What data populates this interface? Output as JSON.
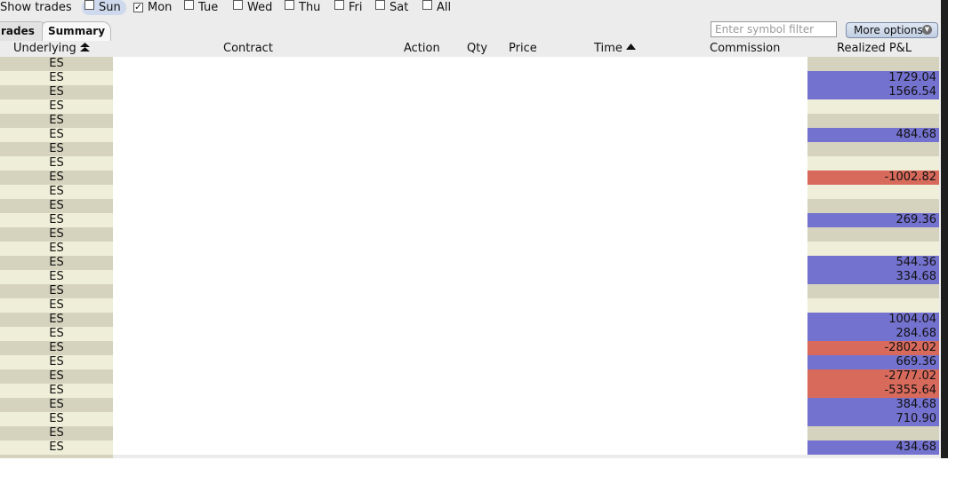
{
  "show_trades": {
    "label": "Show trades",
    "days": [
      {
        "label": "Sun",
        "checked": false,
        "highlighted": true
      },
      {
        "label": "Mon",
        "checked": true,
        "highlighted": false
      },
      {
        "label": "Tue",
        "checked": false,
        "highlighted": false
      },
      {
        "label": "Wed",
        "checked": false,
        "highlighted": false
      },
      {
        "label": "Thu",
        "checked": false,
        "highlighted": false
      },
      {
        "label": "Fri",
        "checked": false,
        "highlighted": false
      },
      {
        "label": "Sat",
        "checked": false,
        "highlighted": false
      },
      {
        "label": "All",
        "checked": false,
        "highlighted": false
      }
    ]
  },
  "tabs": [
    {
      "label": "rades",
      "active": false
    },
    {
      "label": "Summary",
      "active": true
    }
  ],
  "symbol_filter": {
    "placeholder": "Enter symbol filter",
    "value": ""
  },
  "more_options": {
    "label": "More options"
  },
  "columns": {
    "underlying": "Underlying",
    "contract": "Contract",
    "action": "Action",
    "qty": "Qty",
    "price": "Price",
    "time": "Time",
    "commission": "Commission",
    "realized_pnl": "Realized P&L"
  },
  "sort_icons": {
    "underlying": "double-up-arrow-icon",
    "time": "up-triangle-icon"
  },
  "colors": {
    "positive_pnl": "#7472cf",
    "negative_pnl": "#d86a5c",
    "stripe_odd": "#d5d3be",
    "stripe_even": "#efeed8"
  },
  "rows": [
    {
      "underlying": "ES",
      "pnl": ""
    },
    {
      "underlying": "ES",
      "pnl": "1729.04"
    },
    {
      "underlying": "ES",
      "pnl": "1566.54"
    },
    {
      "underlying": "ES",
      "pnl": ""
    },
    {
      "underlying": "ES",
      "pnl": ""
    },
    {
      "underlying": "ES",
      "pnl": "484.68"
    },
    {
      "underlying": "ES",
      "pnl": ""
    },
    {
      "underlying": "ES",
      "pnl": ""
    },
    {
      "underlying": "ES",
      "pnl": "-1002.82"
    },
    {
      "underlying": "ES",
      "pnl": ""
    },
    {
      "underlying": "ES",
      "pnl": ""
    },
    {
      "underlying": "ES",
      "pnl": "269.36"
    },
    {
      "underlying": "ES",
      "pnl": ""
    },
    {
      "underlying": "ES",
      "pnl": ""
    },
    {
      "underlying": "ES",
      "pnl": "544.36"
    },
    {
      "underlying": "ES",
      "pnl": "334.68"
    },
    {
      "underlying": "ES",
      "pnl": ""
    },
    {
      "underlying": "ES",
      "pnl": ""
    },
    {
      "underlying": "ES",
      "pnl": "1004.04"
    },
    {
      "underlying": "ES",
      "pnl": "284.68"
    },
    {
      "underlying": "ES",
      "pnl": "-2802.02"
    },
    {
      "underlying": "ES",
      "pnl": "669.36"
    },
    {
      "underlying": "ES",
      "pnl": "-2777.02"
    },
    {
      "underlying": "ES",
      "pnl": "-5355.64"
    },
    {
      "underlying": "ES",
      "pnl": "384.68"
    },
    {
      "underlying": "ES",
      "pnl": "710.90"
    },
    {
      "underlying": "ES",
      "pnl": ""
    },
    {
      "underlying": "ES",
      "pnl": "434.68"
    }
  ]
}
